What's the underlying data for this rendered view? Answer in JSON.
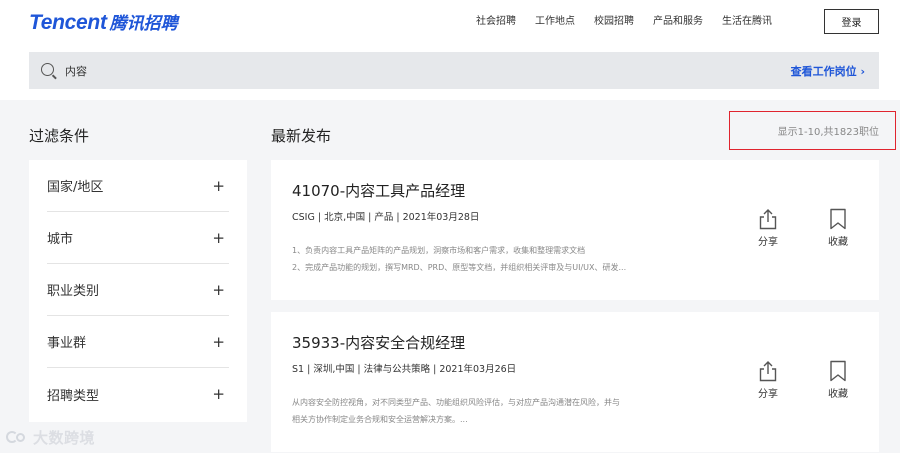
{
  "logo": {
    "en": "Tencent",
    "cn": "腾讯招聘"
  },
  "nav": {
    "items": [
      "社会招聘",
      "工作地点",
      "校园招聘",
      "产品和服务",
      "生活在腾讯"
    ],
    "login_label": "登录"
  },
  "search": {
    "value": "内容",
    "link_label": "查看工作岗位 ›"
  },
  "filters": {
    "title": "过滤条件",
    "items": [
      "国家/地区",
      "城市",
      "职业类别",
      "事业群",
      "招聘类型"
    ],
    "expand_symbol": "+"
  },
  "results": {
    "title": "最新发布",
    "count_text": "显示1-10,共1823职位"
  },
  "jobs": [
    {
      "title": "41070-内容工具产品经理",
      "meta": "CSIG | 北京,中国 | 产品 | 2021年03月28日",
      "desc": [
        "1、负责内容工具产品矩阵的产品规划，洞察市场和客户需求，收集和整理需求文档",
        "2、完成产品功能的规划，撰写MRD、PRD、原型等文档，并组织相关评审及与UI/UX、研发..."
      ],
      "share_label": "分享",
      "fav_label": "收藏"
    },
    {
      "title": "35933-内容安全合规经理",
      "meta": "S1 | 深圳,中国 | 法律与公共策略 | 2021年03月26日",
      "desc": [
        "从内容安全防控视角，对不同类型产品、功能组织风险评估，与对应产品沟通潜在风险，并与",
        "相关方协作制定业务合规和安全运营解决方案。..."
      ],
      "share_label": "分享",
      "fav_label": "收藏"
    }
  ],
  "watermark": {
    "text": "大数跨境"
  },
  "colors": {
    "brand": "#1f56d8",
    "highlight_border": "#e0242e"
  }
}
